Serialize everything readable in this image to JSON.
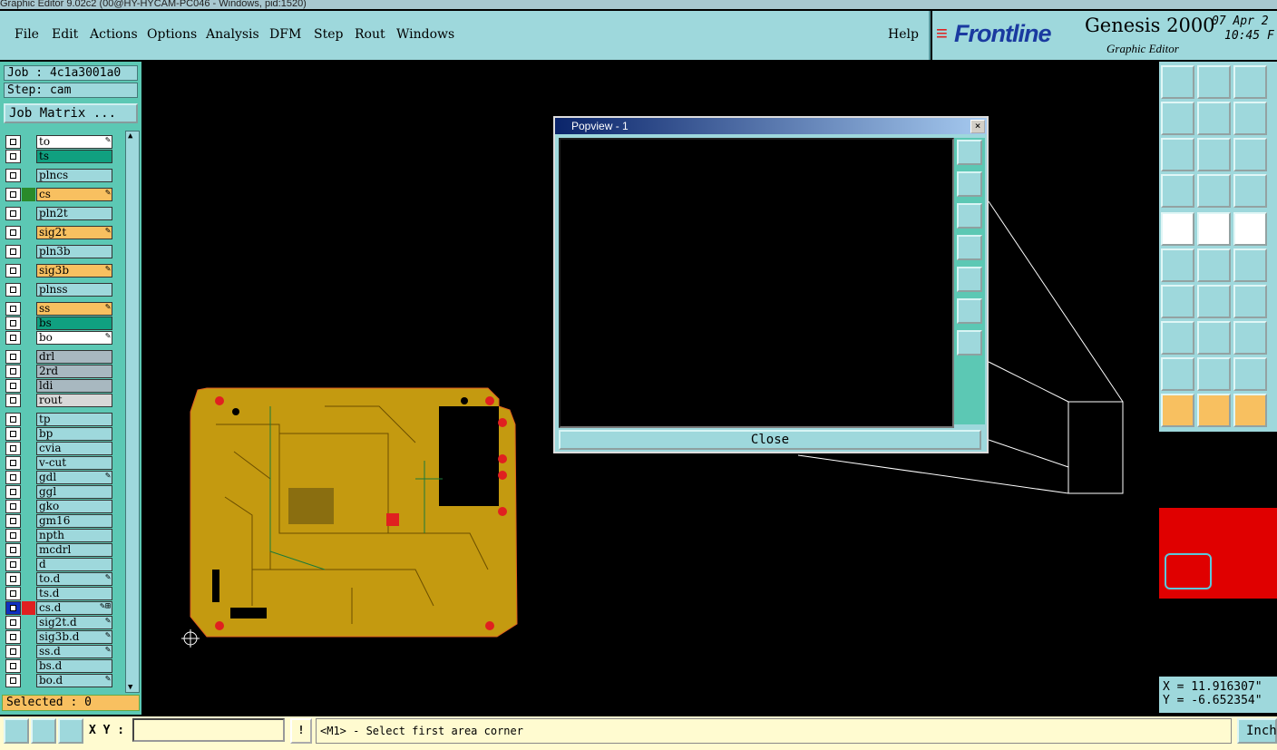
{
  "title_bar": "Graphic Editor 9.02c2 (00@HY-HYCAM-PC046 - Windows, pid:1520)",
  "menu": {
    "items": [
      "File",
      "Edit",
      "Actions",
      "Options",
      "Analysis",
      "DFM",
      "Step",
      "Rout",
      "Windows"
    ],
    "help": "Help"
  },
  "brand": {
    "logo": "Frontline",
    "product": "Genesis 2000",
    "subtitle": "Graphic Editor",
    "date": "07 Apr 2",
    "time": "10:45 F"
  },
  "left_panel": {
    "job": "Job : 4c1a3001a0",
    "step": "Step: cam",
    "job_matrix_button": "Job Matrix ..."
  },
  "layers": [
    {
      "name": "to",
      "color": "#ffffff",
      "swatch": "",
      "mark": "✎"
    },
    {
      "name": "ts",
      "color": "#10a080",
      "swatch": "",
      "mark": ""
    },
    {
      "name": "plncs",
      "color": "#9ed8dc",
      "swatch": "",
      "mark": ""
    },
    {
      "name": "cs",
      "color": "#f8c060",
      "swatch": "#2a8a2a",
      "mark": "✎"
    },
    {
      "name": "pln2t",
      "color": "#9ed8dc",
      "swatch": "",
      "mark": ""
    },
    {
      "name": "sig2t",
      "color": "#f8c060",
      "swatch": "",
      "mark": "✎"
    },
    {
      "name": "pln3b",
      "color": "#9ed8dc",
      "swatch": "",
      "mark": ""
    },
    {
      "name": "sig3b",
      "color": "#f8c060",
      "swatch": "",
      "mark": "✎"
    },
    {
      "name": "plnss",
      "color": "#9ed8dc",
      "swatch": "",
      "mark": ""
    },
    {
      "name": "ss",
      "color": "#f8c060",
      "swatch": "",
      "mark": "✎"
    },
    {
      "name": "bs",
      "color": "#10a080",
      "swatch": "",
      "mark": ""
    },
    {
      "name": "bo",
      "color": "#ffffff",
      "swatch": "",
      "mark": "✎"
    },
    {
      "name": "drl",
      "color": "#a8b8c0",
      "swatch": "",
      "mark": ""
    },
    {
      "name": "2rd",
      "color": "#a8b8c0",
      "swatch": "",
      "mark": ""
    },
    {
      "name": "ldi",
      "color": "#a8b8c0",
      "swatch": "",
      "mark": ""
    },
    {
      "name": "rout",
      "color": "#d8d8d8",
      "swatch": "",
      "mark": ""
    },
    {
      "name": "tp",
      "color": "#9ed8dc",
      "swatch": "",
      "mark": ""
    },
    {
      "name": "bp",
      "color": "#9ed8dc",
      "swatch": "",
      "mark": ""
    },
    {
      "name": "cvia",
      "color": "#9ed8dc",
      "swatch": "",
      "mark": ""
    },
    {
      "name": "v-cut",
      "color": "#9ed8dc",
      "swatch": "",
      "mark": ""
    },
    {
      "name": "gdl",
      "color": "#9ed8dc",
      "swatch": "",
      "mark": "✎"
    },
    {
      "name": "ggl",
      "color": "#9ed8dc",
      "swatch": "",
      "mark": ""
    },
    {
      "name": "gko",
      "color": "#9ed8dc",
      "swatch": "",
      "mark": ""
    },
    {
      "name": "gm16",
      "color": "#9ed8dc",
      "swatch": "",
      "mark": ""
    },
    {
      "name": "npth",
      "color": "#9ed8dc",
      "swatch": "",
      "mark": ""
    },
    {
      "name": "mcdrl",
      "color": "#9ed8dc",
      "swatch": "",
      "mark": ""
    },
    {
      "name": "d",
      "color": "#9ed8dc",
      "swatch": "",
      "mark": ""
    },
    {
      "name": "to.d",
      "color": "#9ed8dc",
      "swatch": "",
      "mark": "✎"
    },
    {
      "name": "ts.d",
      "color": "#9ed8dc",
      "swatch": "",
      "mark": ""
    },
    {
      "name": "cs.d",
      "color": "#9ed8dc",
      "swatch": "#e02020",
      "mark": "✎⊞",
      "checkbox": "#1030c0"
    },
    {
      "name": "sig2t.d",
      "color": "#9ed8dc",
      "swatch": "",
      "mark": "✎"
    },
    {
      "name": "sig3b.d",
      "color": "#9ed8dc",
      "swatch": "",
      "mark": "✎"
    },
    {
      "name": "ss.d",
      "color": "#9ed8dc",
      "swatch": "",
      "mark": "✎"
    },
    {
      "name": "bs.d",
      "color": "#9ed8dc",
      "swatch": "",
      "mark": ""
    },
    {
      "name": "bo.d",
      "color": "#9ed8dc",
      "swatch": "",
      "mark": "✎"
    }
  ],
  "selected": "Selected : 0",
  "popview": {
    "title": "Popview - 1",
    "close_x": "×",
    "close_button": "Close"
  },
  "coords": {
    "x": "X = 11.916307\"",
    "y": "Y = -6.652354\""
  },
  "status": {
    "xy_label": "X Y :",
    "xy_value": "",
    "warn": "!",
    "prompt": "<M1> - Select first area corner",
    "units": "Inch"
  },
  "toolbar_icons": [
    "zoom-home",
    "zoom-in",
    "zoom-house",
    "zoom-pan-left",
    "zoom-pan-right",
    "zoom-swap",
    "zoom-fit",
    "zoom-center",
    "zoom-1to2",
    "measure-settings",
    "snap-point",
    "net-graph",
    "grid-display",
    "select-region",
    "ruler",
    "connect-nodes",
    "delete-node",
    "move-point",
    "draw-line",
    "draw-line-blue",
    "rotate",
    "add-pad",
    "line-segment",
    "stretch",
    "triangle-a",
    "triangle-b",
    "triangle-c",
    "pointer",
    "pointer-box",
    "pointer-tag"
  ]
}
